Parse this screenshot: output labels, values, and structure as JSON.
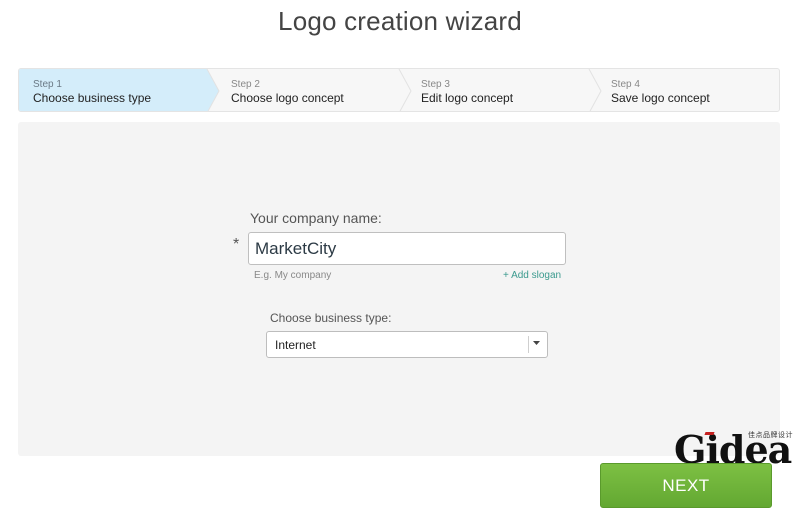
{
  "page": {
    "title": "Logo creation wizard"
  },
  "steps": [
    {
      "number": "Step 1",
      "label": "Choose business type",
      "active": true
    },
    {
      "number": "Step 2",
      "label": "Choose logo concept",
      "active": false
    },
    {
      "number": "Step 3",
      "label": "Edit logo concept",
      "active": false
    },
    {
      "number": "Step 4",
      "label": "Save logo concept",
      "active": false
    }
  ],
  "form": {
    "company_label": "Your company name:",
    "required_mark": "*",
    "company_value": "MarketCity",
    "company_hint": "E.g. My company",
    "add_slogan": "+ Add slogan",
    "business_type_label": "Choose business type:",
    "business_type_value": "Internet"
  },
  "watermark": {
    "word": "Gidea",
    "subtitle": "佳点品牌设计"
  },
  "actions": {
    "next_label": "NEXT"
  },
  "colors": {
    "active_step": "#d4edfa",
    "accent_link": "#3b9a8e",
    "next_button": "#6cb33a"
  }
}
